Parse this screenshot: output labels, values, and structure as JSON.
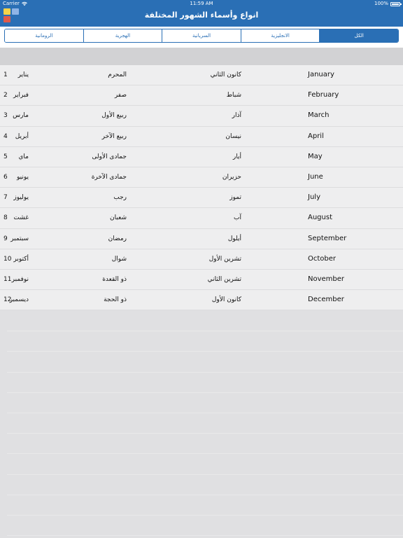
{
  "status_bar": {
    "carrier": "Carrier",
    "time": "11:59 AM",
    "battery": "100%"
  },
  "nav": {
    "title": "انواع وأسماء الشهور المختلفة",
    "menu_icon": "app-grid-icon",
    "colors": {
      "bar": "#2a6fb5",
      "squares": [
        "#f5d34a",
        "#8fb4e6",
        "#e05a4a",
        "#2a6fb5"
      ]
    }
  },
  "segments": [
    {
      "label": "الرومانية",
      "active": false
    },
    {
      "label": "الهجرية",
      "active": false
    },
    {
      "label": "السريانية",
      "active": false
    },
    {
      "label": "الانجليزية",
      "active": false
    },
    {
      "label": "الكل",
      "active": true
    }
  ],
  "months": [
    {
      "num": "1",
      "roman": "يناير",
      "hijri": "المحرم",
      "syriac": "كانون الثاني",
      "english": "January"
    },
    {
      "num": "2",
      "roman": "فبراير",
      "hijri": "صفر",
      "syriac": "شباط",
      "english": "February"
    },
    {
      "num": "3",
      "roman": "مارس",
      "hijri": "ربيع الأول",
      "syriac": "آذار",
      "english": "March"
    },
    {
      "num": "4",
      "roman": "أبريل",
      "hijri": "ربيع الآخر",
      "syriac": "نيسان",
      "english": "April"
    },
    {
      "num": "5",
      "roman": "ماي",
      "hijri": "جمادى الأولى",
      "syriac": "أيار",
      "english": "May"
    },
    {
      "num": "6",
      "roman": "يونيو",
      "hijri": "جمادى الآخرة",
      "syriac": "حزيران",
      "english": "June"
    },
    {
      "num": "7",
      "roman": "يوليوز",
      "hijri": "رجب",
      "syriac": "تموز",
      "english": "July"
    },
    {
      "num": "8",
      "roman": "غشت",
      "hijri": "شعبان",
      "syriac": "آب",
      "english": "August"
    },
    {
      "num": "9",
      "roman": "سبتمبر",
      "hijri": "رمضان",
      "syriac": "أيلول",
      "english": "September"
    },
    {
      "num": "10",
      "roman": "أكتوبر",
      "hijri": "شوال",
      "syriac": "تشرين الأول",
      "english": "October"
    },
    {
      "num": "11",
      "roman": "نوفمبر",
      "hijri": "ذو القعدة",
      "syriac": "تشرين الثاني",
      "english": "November"
    },
    {
      "num": "12",
      "roman": "ديسمبر",
      "hijri": "ذو الحجة",
      "syriac": "كانون الأول",
      "english": "December"
    }
  ]
}
